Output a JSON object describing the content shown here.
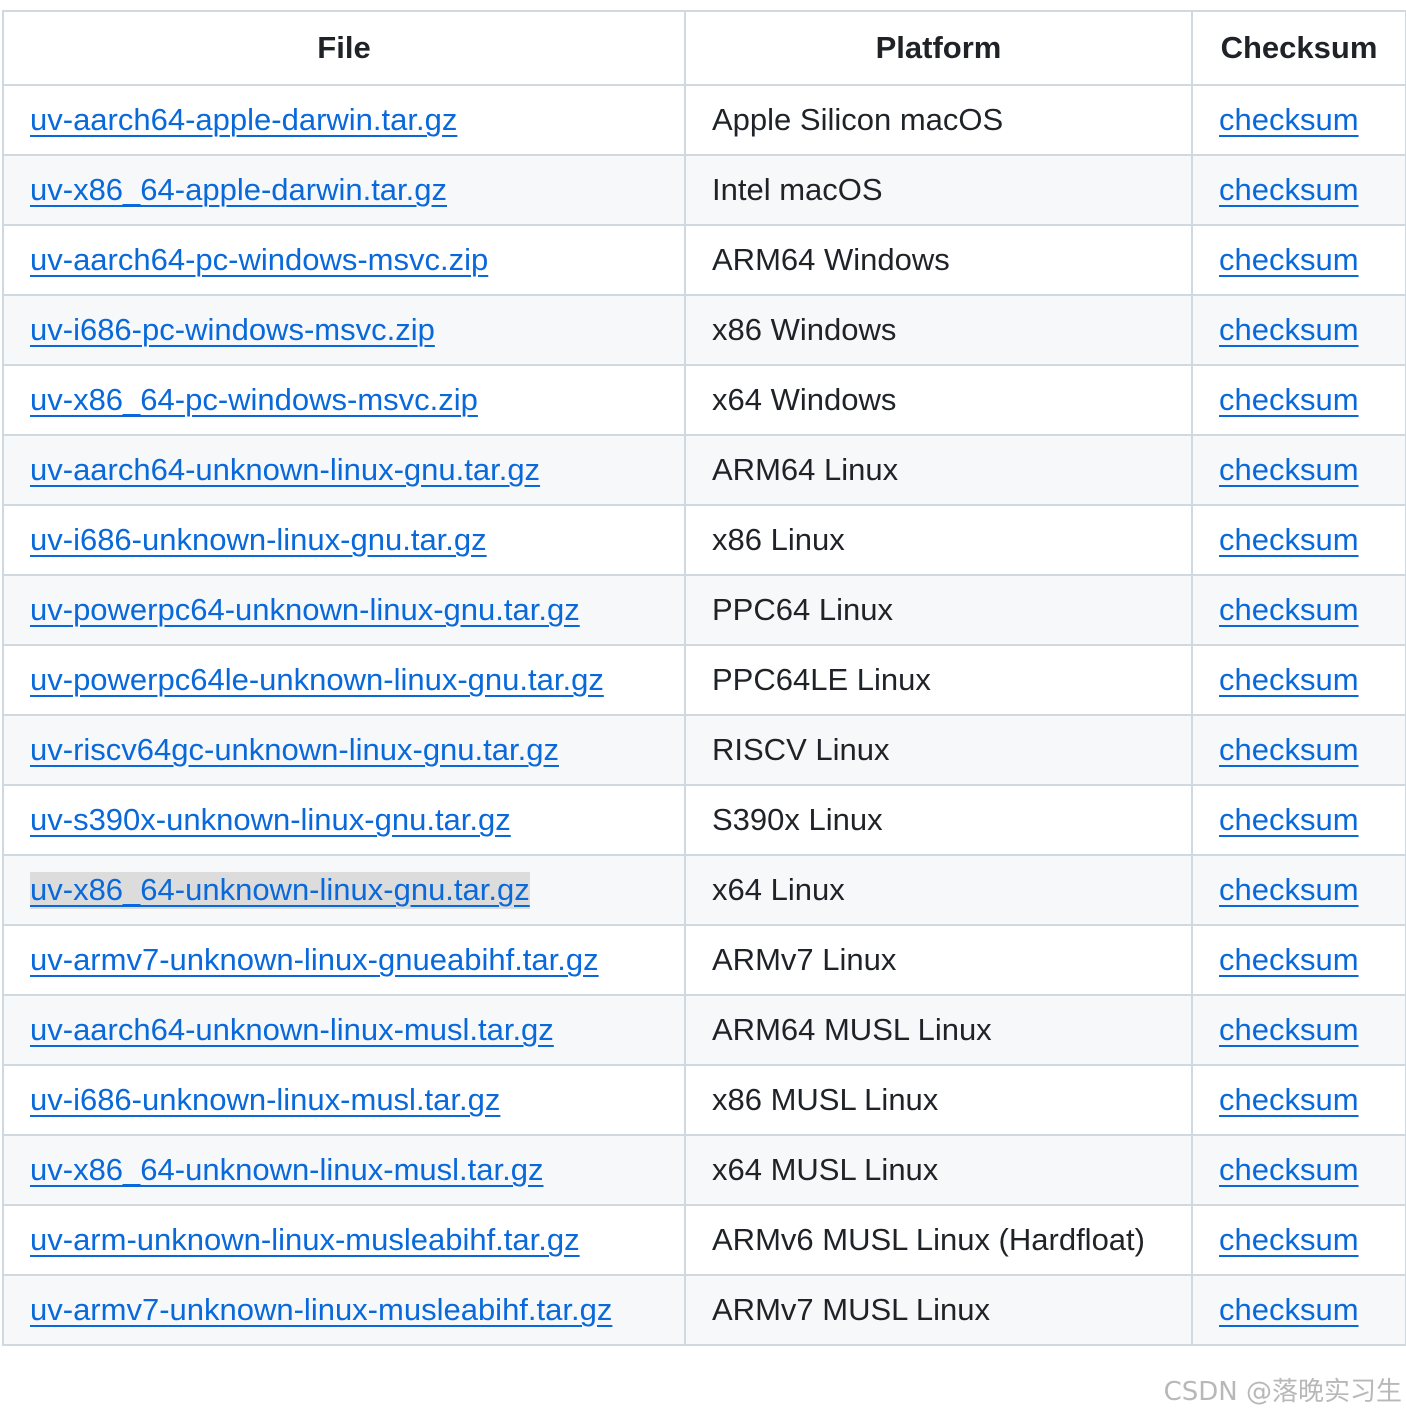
{
  "table": {
    "headers": {
      "file": "File",
      "platform": "Platform",
      "checksum": "Checksum"
    },
    "highlighted_row": 11,
    "rows": [
      {
        "file": "uv-aarch64-apple-darwin.tar.gz",
        "platform": "Apple Silicon macOS",
        "checksum": "checksum"
      },
      {
        "file": "uv-x86_64-apple-darwin.tar.gz",
        "platform": "Intel macOS",
        "checksum": "checksum"
      },
      {
        "file": "uv-aarch64-pc-windows-msvc.zip",
        "platform": "ARM64 Windows",
        "checksum": "checksum"
      },
      {
        "file": "uv-i686-pc-windows-msvc.zip",
        "platform": "x86 Windows",
        "checksum": "checksum"
      },
      {
        "file": "uv-x86_64-pc-windows-msvc.zip",
        "platform": "x64 Windows",
        "checksum": "checksum"
      },
      {
        "file": "uv-aarch64-unknown-linux-gnu.tar.gz",
        "platform": "ARM64 Linux",
        "checksum": "checksum"
      },
      {
        "file": "uv-i686-unknown-linux-gnu.tar.gz",
        "platform": "x86 Linux",
        "checksum": "checksum"
      },
      {
        "file": "uv-powerpc64-unknown-linux-gnu.tar.gz",
        "platform": "PPC64 Linux",
        "checksum": "checksum"
      },
      {
        "file": "uv-powerpc64le-unknown-linux-gnu.tar.gz",
        "platform": "PPC64LE Linux",
        "checksum": "checksum"
      },
      {
        "file": "uv-riscv64gc-unknown-linux-gnu.tar.gz",
        "platform": "RISCV Linux",
        "checksum": "checksum"
      },
      {
        "file": "uv-s390x-unknown-linux-gnu.tar.gz",
        "platform": "S390x Linux",
        "checksum": "checksum"
      },
      {
        "file": "uv-x86_64-unknown-linux-gnu.tar.gz",
        "platform": "x64 Linux",
        "checksum": "checksum"
      },
      {
        "file": "uv-armv7-unknown-linux-gnueabihf.tar.gz",
        "platform": "ARMv7 Linux",
        "checksum": "checksum"
      },
      {
        "file": "uv-aarch64-unknown-linux-musl.tar.gz",
        "platform": "ARM64 MUSL Linux",
        "checksum": "checksum"
      },
      {
        "file": "uv-i686-unknown-linux-musl.tar.gz",
        "platform": "x86 MUSL Linux",
        "checksum": "checksum"
      },
      {
        "file": "uv-x86_64-unknown-linux-musl.tar.gz",
        "platform": "x64 MUSL Linux",
        "checksum": "checksum"
      },
      {
        "file": "uv-arm-unknown-linux-musleabihf.tar.gz",
        "platform": "ARMv6 MUSL Linux (Hardfloat)",
        "checksum": "checksum"
      },
      {
        "file": "uv-armv7-unknown-linux-musleabihf.tar.gz",
        "platform": "ARMv7 MUSL Linux",
        "checksum": "checksum"
      }
    ]
  },
  "watermark": "CSDN @落晚实习生",
  "colors": {
    "link": "#0969da",
    "border": "#d1d9e0",
    "stripe": "#f6f8fa",
    "highlight": "#dcdcdc"
  }
}
